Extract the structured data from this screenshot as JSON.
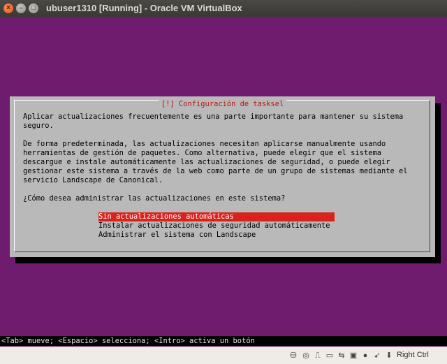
{
  "window": {
    "title": "ubuser1310 [Running] - Oracle VM VirtualBox",
    "close_glyph": "×",
    "min_glyph": "–",
    "max_glyph": "□"
  },
  "dialog": {
    "title": "[!] Configuración de tasksel",
    "paragraph1": [
      "Aplicar actualizaciones frecuentemente es una parte importante para mantener su sistema",
      "seguro."
    ],
    "paragraph2": [
      "De forma predeterminada, las actualizaciones necesitan aplicarse manualmente usando",
      "herramientas de gestión de paquetes. Como alternativa, puede elegir que el sistema",
      "descargue e instale automáticamente las actualizaciones de seguridad, o puede elegir",
      "gestionar este sistema a través de la web como parte de un grupo de sistemas mediante el",
      "servicio Landscape de Canonical."
    ],
    "question": "¿Cómo desea administrar las actualizaciones en este sistema?",
    "options": [
      {
        "label": "Sin actualizaciones automáticas",
        "selected": true
      },
      {
        "label": "Instalar actualizaciones de seguridad automáticamente",
        "selected": false
      },
      {
        "label": "Administrar el sistema con Landscape",
        "selected": false
      }
    ]
  },
  "console_status": "<Tab> mueve; <Espacio> selecciona; <Intro> activa un botón",
  "vb_statusbar": {
    "icons": [
      {
        "name": "hard-disk-icon",
        "glyph": "⛁"
      },
      {
        "name": "optical-drive-icon",
        "glyph": "◎"
      },
      {
        "name": "usb-icon",
        "glyph": "⎍"
      },
      {
        "name": "shared-folders-icon",
        "glyph": "▭"
      },
      {
        "name": "network-icon",
        "glyph": "⇆"
      },
      {
        "name": "display-icon",
        "glyph": "▣"
      },
      {
        "name": "video-capture-icon",
        "glyph": "●"
      },
      {
        "name": "mouse-integration-icon",
        "glyph": "➹"
      },
      {
        "name": "keyboard-icon",
        "glyph": "⬇"
      }
    ],
    "host_key": "Right Ctrl"
  },
  "colors": {
    "vm_background": "#6f1c6e",
    "dialog_background": "#b9b9b9",
    "selected_option": "#d8221c",
    "dialog_title": "#b5121b"
  }
}
